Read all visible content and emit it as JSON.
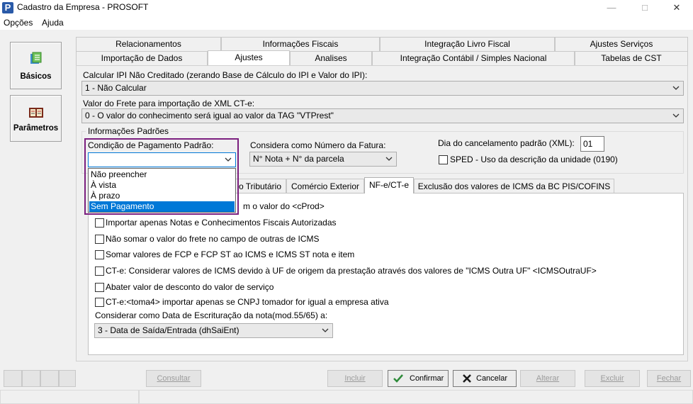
{
  "window": {
    "title": "Cadastro da Empresa - PROSOFT",
    "app_icon": "P"
  },
  "menu": [
    "Opções",
    "Ajuda"
  ],
  "nav": [
    {
      "label": "Básicos",
      "icon": "basicos-icon"
    },
    {
      "label": "Parâmetros",
      "icon": "parametros-icon"
    }
  ],
  "tabs_row1": [
    "Relacionamentos",
    "Informações Fiscais",
    "Integração Livro Fiscal",
    "Ajustes Serviços"
  ],
  "tabs_row2": [
    "Importação de Dados",
    "Ajustes",
    "Analises",
    "Integração Contábil / Simples Nacional",
    "Tabelas de CST"
  ],
  "active_tab": "Ajustes",
  "ipi": {
    "label": "Calcular IPI Não Creditado (zerando Base de Cálculo do IPI e Valor do IPI):",
    "value": "1 - Não Calcular"
  },
  "frete": {
    "label": "Valor do Frete para importação de XML CT-e:",
    "value": "0 - O valor do conhecimento será igual ao valor da TAG \"VTPrest\""
  },
  "info_padroes": {
    "legend": "Informações Padrões",
    "cond_pag_label": "Condição de Pagamento Padrão:",
    "cond_pag_value": "",
    "fatura_label": "Considera como Número da Fatura:",
    "fatura_value": "N° Nota + N° da parcela",
    "dia_cancel_label": "Dia do cancelamento padrão (XML):",
    "dia_cancel_value": "01",
    "sped_label": "SPED - Uso da descrição da unidade (0190)"
  },
  "dropdown_options": [
    "Não preencher",
    "À vista",
    "À prazo",
    "Sem Pagamento"
  ],
  "dropdown_selected": "Sem Pagamento",
  "inner_tabs": [
    "o Tributário",
    "Comércio Exterior",
    "NF-e/CT-e",
    "Exclusão dos valores de ICMS da BC PIS/COFINS"
  ],
  "inner_active_tab": "NF-e/CT-e",
  "partial_text": "m o valor do <cProd>",
  "checkboxes": [
    "Importar apenas Notas e Conhecimentos Fiscais Autorizadas",
    "Não somar o valor do frete no campo de outras de ICMS",
    "Somar valores de FCP e FCP ST ao ICMS e ICMS ST nota e item",
    "CT-e: Considerar valores de ICMS devido à UF de origem da prestação através dos valores de \"ICMS Outra UF\" <ICMSOutraUF>",
    "Abater valor de desconto do valor de serviço",
    "CT-e:<toma4> importar apenas se CNPJ tomador for igual a empresa ativa"
  ],
  "escrituracao": {
    "label": "Considerar como Data de Escrituração da nota(mod.55/65) a:",
    "value": "3 -  Data de Saída/Entrada (dhSaiEnt)"
  },
  "buttons": {
    "consultar": "Consultar",
    "incluir": "Incluir",
    "confirmar": "Confirmar",
    "cancelar": "Cancelar",
    "alterar": "Alterar",
    "excluir": "Excluir",
    "fechar": "Fechar"
  },
  "colors": {
    "accent": "#0078d7",
    "highlight_border": "#7b1f7f",
    "confirm": "#2e8b3a",
    "cancel": "#1a1a1a"
  }
}
